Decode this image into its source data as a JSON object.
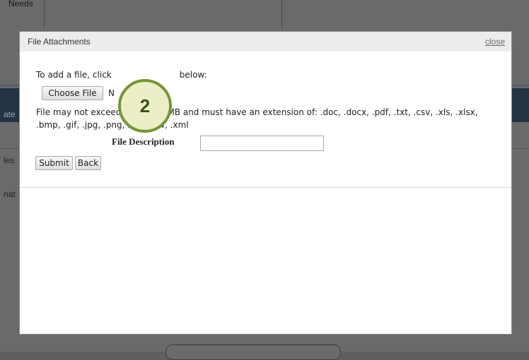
{
  "background": {
    "needs_label": "Needs",
    "fragments": [
      "ate",
      "les",
      "nat"
    ]
  },
  "modal": {
    "title": "File Attachments",
    "close_label": "close",
    "instruction_prefix": "To add a file, click",
    "instruction_suffix": "below:",
    "choose_file_label": "Choose File",
    "no_file_text": "N",
    "callout_number": "2",
    "limit_text": "File may not exceed a size of 5MB and must have an extension of: .doc, .docx, .pdf, .txt, .csv, .xls, .xlsx, .bmp, .gif, .jpg, .png, .rtf, .sdw, .xml",
    "description_label": "File Description",
    "description_value": "",
    "submit_label": "Submit",
    "back_label": "Back"
  },
  "colors": {
    "overlay": "#6a6a6a",
    "navbar": "#233447",
    "callout_border": "#76943a",
    "callout_fill": "#ebeec6"
  }
}
